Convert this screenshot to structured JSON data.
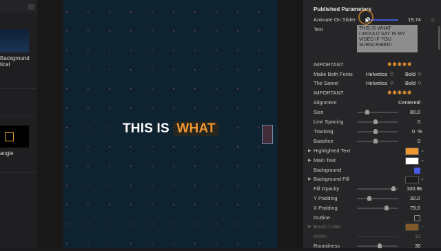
{
  "browser": {
    "items": [
      {
        "label_lines": [
          "Background",
          "tical"
        ]
      },
      {
        "label_lines": [
          "angle"
        ]
      }
    ]
  },
  "viewer": {
    "title_plain": "THIS IS",
    "title_highlight": "WHAT"
  },
  "inspector": {
    "header": "Published Parameters",
    "animate_on_slider": {
      "label": "Animate On Slider",
      "value": "19.74",
      "level": 0.55
    },
    "text": {
      "label": "Text",
      "value": "THIS IS WHAT\nI WOULD SAY IN MY\nVIDEO IF YOU\nSUBSCRIBED!"
    },
    "important1": {
      "label": "IMPORTANT",
      "rating_glyphs": "✱✱✱✱✱"
    },
    "make_both_fonts": {
      "label": "Make Both Fonts",
      "font": "Helvetica",
      "weight": "Bold"
    },
    "the_same": {
      "label": "The Same!",
      "font": "Helvetica",
      "weight": "Bold"
    },
    "important2": {
      "label": "IMPORTANT",
      "rating_glyphs": "✱✱✱✱✱"
    },
    "alignment": {
      "label": "Alignment",
      "value": "Centered"
    },
    "size": {
      "label": "Size",
      "value": "80.0",
      "level": 0.15
    },
    "line_spacing": {
      "label": "Line Spacing",
      "value": "0",
      "level": 0.5
    },
    "tracking": {
      "label": "Tracking",
      "value": "0",
      "unit": "%",
      "level": 0.5
    },
    "baseline": {
      "label": "Baseline",
      "value": "0",
      "level": 0.5
    },
    "highlighted_text": {
      "label": "Highlighted Text",
      "color": "#f0962e"
    },
    "main_text": {
      "label": "Main Text",
      "color": "#ffffff"
    },
    "background": {
      "label": "Background",
      "checked": true
    },
    "background_fill": {
      "label": "Background Fill",
      "color": "#1c1c1c"
    },
    "fill_opacity": {
      "label": "Fill Opacity",
      "value": "100.0",
      "unit": "%",
      "level": 1.0
    },
    "y_padding": {
      "label": "Y Padding",
      "value": "32.0",
      "level": 0.35
    },
    "x_padding": {
      "label": "X Padding",
      "value": "79.0",
      "level": 0.8
    },
    "outline": {
      "label": "Outline",
      "checked": false
    },
    "brush_color": {
      "label": "Brush Color",
      "color": "#f0962e"
    },
    "width": {
      "label": "Width",
      "value": "10"
    },
    "roundness": {
      "label": "Roundness",
      "value": "30"
    }
  },
  "colors": {
    "accent": "#f0962e",
    "viewer_bg": "#0f2230",
    "checkbox_on": "#4a5ae0"
  }
}
